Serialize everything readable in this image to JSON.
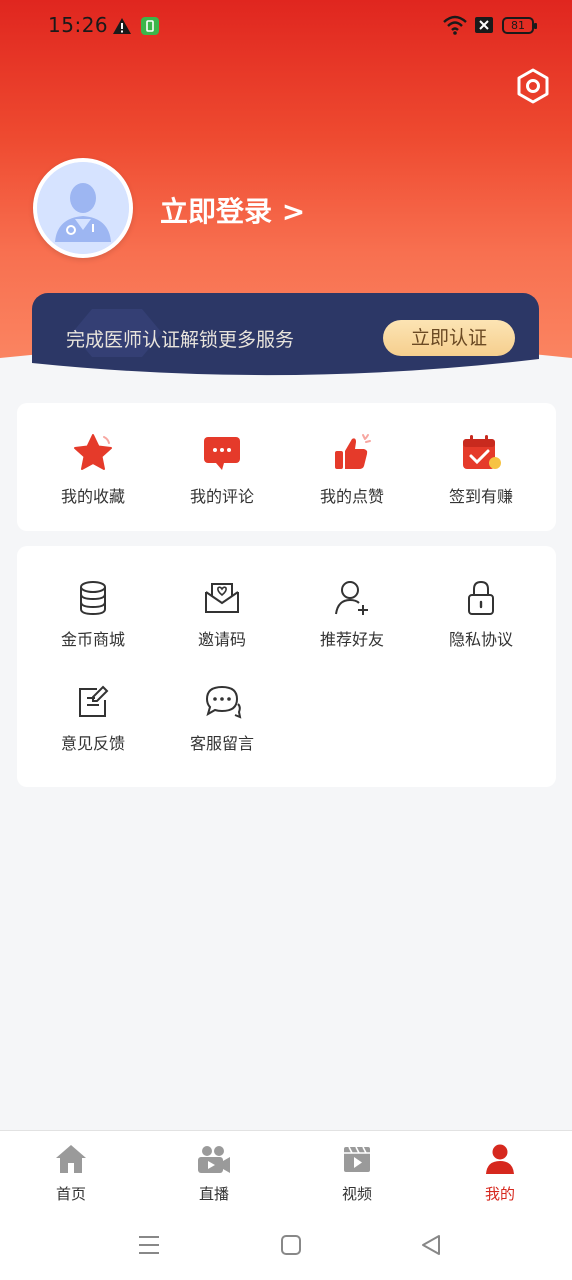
{
  "status": {
    "time": "15:26",
    "battery": "81"
  },
  "colors": {
    "brand": "#e0261f",
    "banner": "#2c3766",
    "gold": "#f6cf8e",
    "active_tab": "#d6281e"
  },
  "profile": {
    "login_label": "立即登录 >",
    "avatar_icon": "doctor-avatar-icon"
  },
  "cert_banner": {
    "text": "完成医师认证解锁更多服务",
    "button_label": "立即认证"
  },
  "quick_actions": [
    {
      "label": "我的收藏",
      "icon": "star-icon"
    },
    {
      "label": "我的评论",
      "icon": "comment-icon"
    },
    {
      "label": "我的点赞",
      "icon": "thumbs-up-icon"
    },
    {
      "label": "签到有赚",
      "icon": "calendar-check-icon"
    }
  ],
  "services": [
    {
      "label": "金币商城",
      "icon": "coins-icon"
    },
    {
      "label": "邀请码",
      "icon": "envelope-heart-icon"
    },
    {
      "label": "推荐好友",
      "icon": "add-user-icon"
    },
    {
      "label": "隐私协议",
      "icon": "lock-icon"
    },
    {
      "label": "意见反馈",
      "icon": "edit-icon"
    },
    {
      "label": "客服留言",
      "icon": "chat-icon"
    }
  ],
  "tabs": [
    {
      "label": "首页",
      "icon": "home-icon"
    },
    {
      "label": "直播",
      "icon": "video-camera-icon"
    },
    {
      "label": "视频",
      "icon": "video-icon"
    },
    {
      "label": "我的",
      "icon": "user-icon",
      "active": true
    }
  ]
}
